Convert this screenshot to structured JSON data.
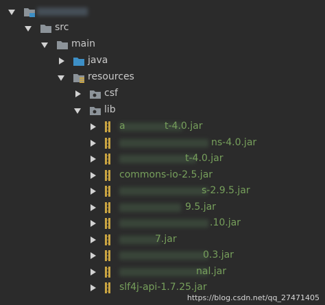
{
  "tree": {
    "project": {
      "label": ""
    },
    "src": {
      "label": "src"
    },
    "main": {
      "label": "main"
    },
    "java": {
      "label": "java"
    },
    "resources": {
      "label": "resources"
    },
    "csf": {
      "label": "csf"
    },
    "lib": {
      "label": "lib"
    },
    "jars": [
      {
        "label": "a",
        "tail": "t-4.0.jar",
        "icon": "jar-icon"
      },
      {
        "label": "",
        "tail": "ns-4.0.jar",
        "icon": "jar-icon"
      },
      {
        "label": "",
        "tail": "t-4.0.jar",
        "icon": "jar-icon"
      },
      {
        "label": "commons-io-2.5.jar",
        "tail": "",
        "icon": "jar-icon"
      },
      {
        "label": "",
        "tail": "s-2.9.5.jar",
        "icon": "jar-icon"
      },
      {
        "label": "",
        "tail": "9.5.jar",
        "icon": "jar-icon"
      },
      {
        "label": "",
        "tail": ".10.jar",
        "icon": "jar-icon"
      },
      {
        "label": "",
        "tail": "7.jar",
        "icon": "jar-icon"
      },
      {
        "label": "",
        "tail": "0.3.jar",
        "icon": "jar-icon"
      },
      {
        "label": "",
        "tail": "nal.jar",
        "icon": "jar-icon"
      },
      {
        "label": "slf4j-api-1.7.25.jar",
        "tail": "",
        "icon": "jar-icon"
      }
    ]
  },
  "watermark": "https://blog.csdn.net/qq_27471405",
  "colors": {
    "background": "#2b2b2b",
    "folder_gray": "#8c9399",
    "folder_blue": "#3d8fc6",
    "jar_text": "#77a05c",
    "jar_icon": "#c9a443"
  }
}
